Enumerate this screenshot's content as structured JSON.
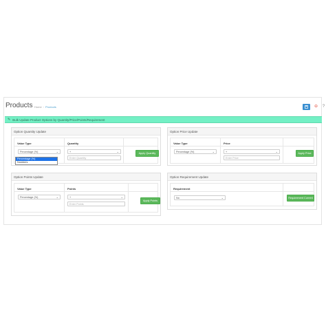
{
  "header": {
    "title": "Products",
    "breadcrumb": [
      "Home",
      "Products"
    ],
    "help_glyph": "?",
    "close_glyph": "⊖"
  },
  "panel": {
    "heading": "Bulk Update Product Options by Quantity/Price/Points/Requirement"
  },
  "quantity_box": {
    "title": "Option Quantity Update",
    "col_value_type": "Value Type",
    "col_quantity": "Quantity",
    "value_type_selected": "Percentage (%)",
    "value_type_options": [
      "Percentage (%)",
      "Numbers"
    ],
    "operator": "+",
    "quantity_placeholder": "Enter Quantity",
    "apply_label": "Apply Quantity"
  },
  "price_box": {
    "title": "Option Price Update",
    "col_value_type": "Value Type",
    "col_price": "Price",
    "value_type_selected": "Percentage (%)",
    "operator": "+",
    "price_placeholder": "Enter Price",
    "apply_label": "Apply Price"
  },
  "points_box": {
    "title": "Option Points Update",
    "col_value_type": "Value Type",
    "col_points": "Points",
    "value_type_selected": "Percentage (%)",
    "operator": "+",
    "points_placeholder": "Enter Points",
    "apply_label": "Apply Points"
  },
  "requirement_box": {
    "title": "Option Requirement Update",
    "col_requirement": "Requirement",
    "requirement_selected": "No",
    "apply_label": "Requirement Current"
  },
  "colors": {
    "heading_bg": "#73f0c5",
    "save_button": "#3a8fd1",
    "apply_button": "#5cb85c",
    "dropdown_selected": "#1e73e8"
  }
}
